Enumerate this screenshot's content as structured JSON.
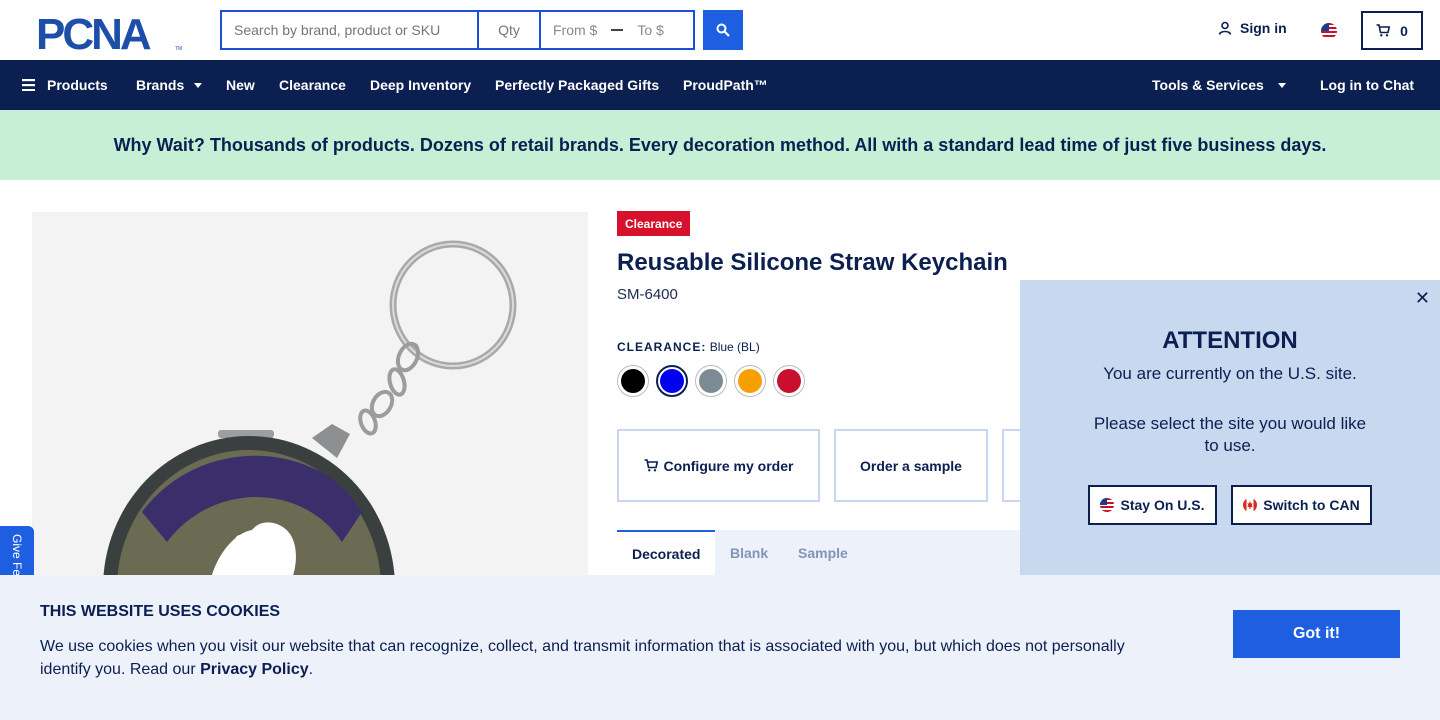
{
  "header": {
    "logo_text": "PCNA",
    "search": {
      "placeholder": "Search by brand, product or SKU",
      "value": ""
    },
    "qty": {
      "placeholder": "Qty",
      "value": ""
    },
    "price_from": "From $",
    "price_to": "To $",
    "signin_label": "Sign in",
    "cart_count": "0",
    "region_flag": "us-flag-icon"
  },
  "nav": {
    "items": [
      {
        "label": "Products",
        "icon": "hamburger-icon"
      },
      {
        "label": "Brands",
        "dropdown": true
      },
      {
        "label": "New"
      },
      {
        "label": "Clearance"
      },
      {
        "label": "Deep Inventory"
      },
      {
        "label": "Perfectly Packaged Gifts"
      },
      {
        "label": "ProudPath™"
      }
    ],
    "tools_label": "Tools & Services",
    "chat_label": "Log in to Chat"
  },
  "promo": {
    "text": "Why Wait? Thousands of products. Dozens of retail brands. Every decoration method. All with a standard lead time of just five business days."
  },
  "product": {
    "badge": "Clearance",
    "title": "Reusable Silicone Straw Keychain",
    "sku": "SM-6400",
    "color_heading": "CLEARANCE:",
    "selected_color": "Blue (BL)",
    "swatches": [
      {
        "name": "Black",
        "hex": "#000000"
      },
      {
        "name": "Blue",
        "hex": "#0000ee",
        "selected": true
      },
      {
        "name": "Gray",
        "hex": "#7b8a93"
      },
      {
        "name": "Orange",
        "hex": "#f5a000"
      },
      {
        "name": "Red",
        "hex": "#c8102e"
      }
    ],
    "actions": {
      "configure": "Configure my order",
      "sample": "Order a sample"
    },
    "tabs": [
      "Decorated",
      "Blank",
      "Sample"
    ],
    "active_tab": "Decorated"
  },
  "attention": {
    "heading": "ATTENTION",
    "line1": "You are currently on the U.S. site.",
    "line2": "Please select the site you would like to use.",
    "stay_label": "Stay On U.S.",
    "switch_label": "Switch to CAN"
  },
  "feedback": {
    "label": "Give Fe"
  },
  "cookie": {
    "heading": "THIS WEBSITE USES COOKIES",
    "text_before": "We use cookies when you visit our website that can recognize, collect, and transmit information that is associated with you, but which does not personally identify you. Read our ",
    "link": "Privacy Policy",
    "text_after": ".",
    "button": "Got it!"
  },
  "colors": {
    "navy": "#0b1f51",
    "accent_blue": "#1d5fe0",
    "promo_green": "#c6efd5",
    "clearance_red": "#d7102c",
    "attention_bg": "#c7d8ef",
    "cookie_bg": "#ecf1fa"
  }
}
